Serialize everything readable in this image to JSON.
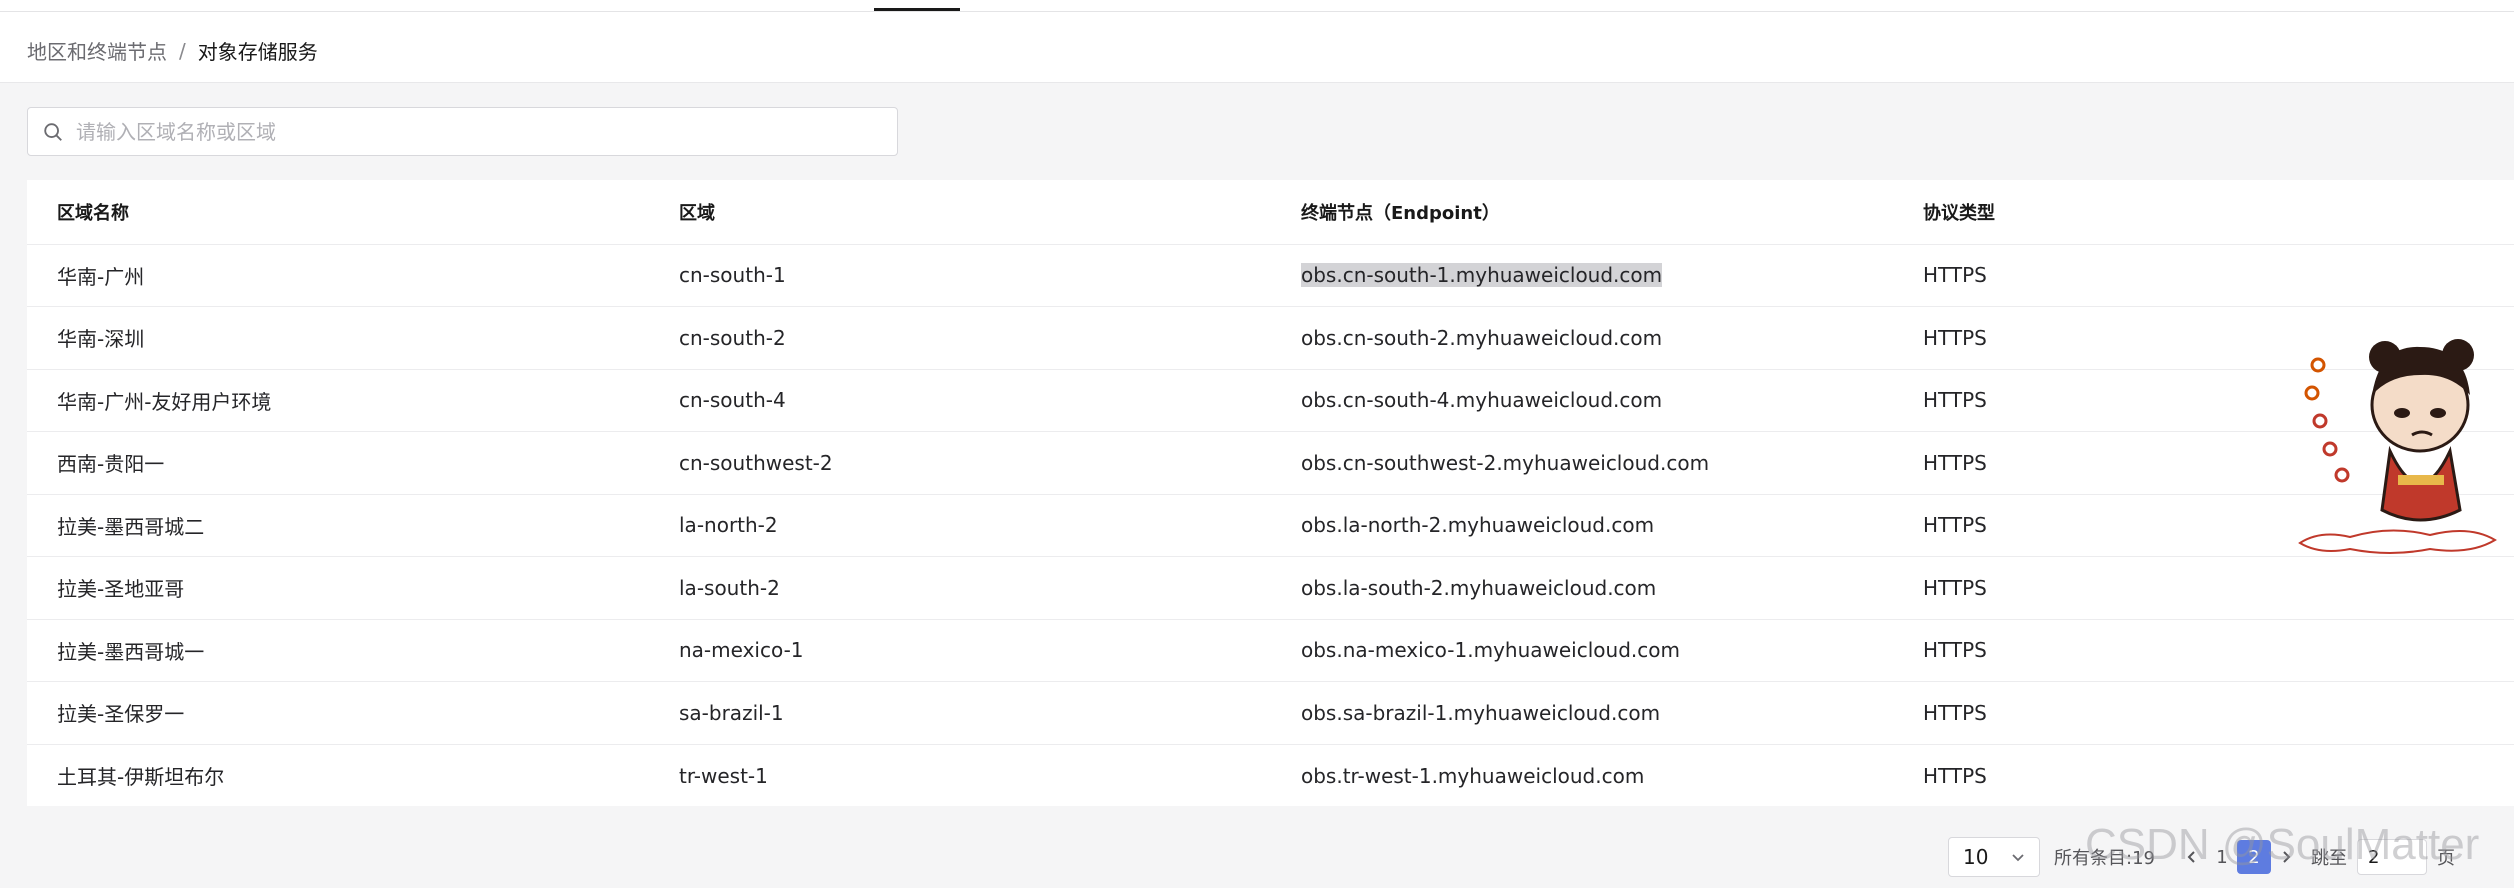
{
  "breadcrumb": {
    "parent": "地区和终端节点",
    "separator": "/",
    "current": "对象存储服务"
  },
  "search": {
    "placeholder": "请输入区域名称或区域",
    "value": ""
  },
  "table": {
    "columns": [
      "区域名称",
      "区域",
      "终端节点（Endpoint）",
      "协议类型"
    ],
    "rows": [
      {
        "name": "华南-广州",
        "region": "cn-south-1",
        "endpoint": "obs.cn-south-1.myhuaweicloud.com",
        "protocol": "HTTPS"
      },
      {
        "name": "华南-深圳",
        "region": "cn-south-2",
        "endpoint": "obs.cn-south-2.myhuaweicloud.com",
        "protocol": "HTTPS"
      },
      {
        "name": "华南-广州-友好用户环境",
        "region": "cn-south-4",
        "endpoint": "obs.cn-south-4.myhuaweicloud.com",
        "protocol": "HTTPS"
      },
      {
        "name": "西南-贵阳一",
        "region": "cn-southwest-2",
        "endpoint": "obs.cn-southwest-2.myhuaweicloud.com",
        "protocol": "HTTPS"
      },
      {
        "name": "拉美-墨西哥城二",
        "region": "la-north-2",
        "endpoint": "obs.la-north-2.myhuaweicloud.com",
        "protocol": "HTTPS"
      },
      {
        "name": "拉美-圣地亚哥",
        "region": "la-south-2",
        "endpoint": "obs.la-south-2.myhuaweicloud.com",
        "protocol": "HTTPS"
      },
      {
        "name": "拉美-墨西哥城一",
        "region": "na-mexico-1",
        "endpoint": "obs.na-mexico-1.myhuaweicloud.com",
        "protocol": "HTTPS"
      },
      {
        "name": "拉美-圣保罗一",
        "region": "sa-brazil-1",
        "endpoint": "obs.sa-brazil-1.myhuaweicloud.com",
        "protocol": "HTTPS"
      },
      {
        "name": "土耳其-伊斯坦布尔",
        "region": "tr-west-1",
        "endpoint": "obs.tr-west-1.myhuaweicloud.com",
        "protocol": "HTTPS"
      }
    ]
  },
  "pagination": {
    "page_size": "10",
    "total_label": "所有条目:19",
    "pages": [
      "1",
      "2"
    ],
    "current_page": "2",
    "goto_label": "跳至",
    "goto_value": "2",
    "goto_suffix": "页"
  },
  "watermark": "CSDN @SoulMatter",
  "colors": {
    "accent": "#5e7ce0",
    "selection_highlight": "#d3d3d6",
    "page_background": "#f5f5f6"
  },
  "icons": {
    "search": "search-icon",
    "page_size_dropdown": "chevron-down-icon",
    "prev": "chevron-left-icon",
    "next": "chevron-right-icon"
  }
}
